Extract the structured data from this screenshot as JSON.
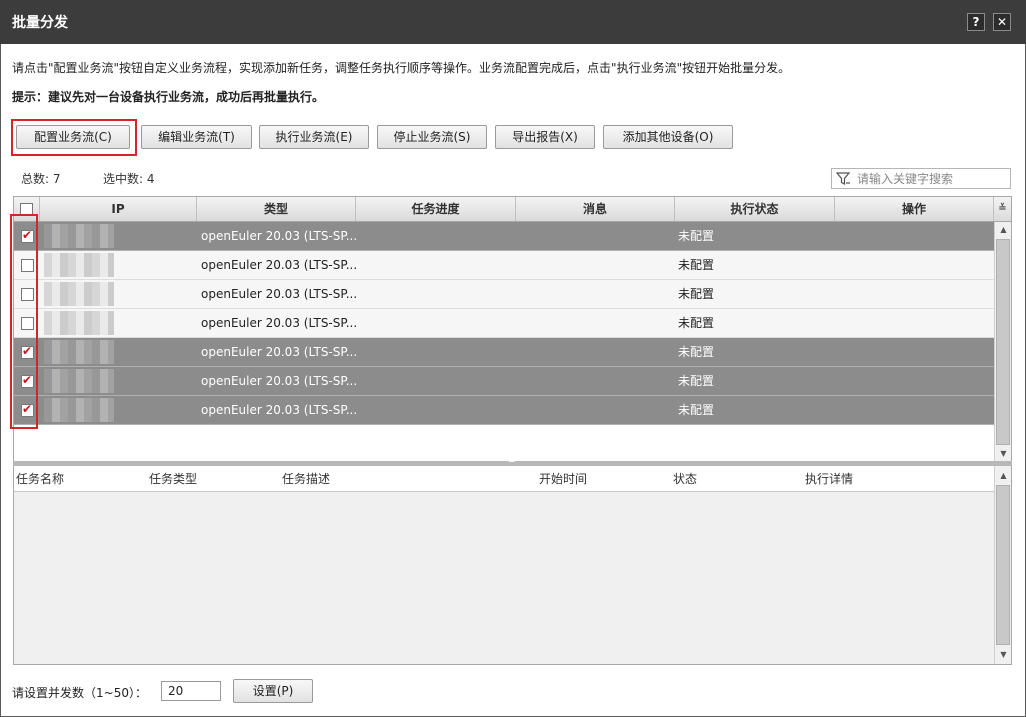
{
  "window": {
    "title": "批量分发",
    "help_label": "?",
    "close_label": "✕"
  },
  "intro_text": "请点击\"配置业务流\"按钮自定义业务流程，实现添加新任务，调整任务执行顺序等操作。业务流配置完成后，点击\"执行业务流\"按钮开始批量分发。",
  "tip_text": "提示：建议先对一台设备执行业务流，成功后再批量执行。",
  "toolbar": {
    "configure": "配置业务流(C)",
    "edit": "编辑业务流(T)",
    "execute": "执行业务流(E)",
    "stop": "停止业务流(S)",
    "export": "导出报告(X)",
    "add_device": "添加其他设备(O)"
  },
  "summary": {
    "total": "总数: 7",
    "selected": "选中数: 4"
  },
  "search": {
    "placeholder": "请输入关键字搜索"
  },
  "device_table": {
    "columns": [
      "IP",
      "类型",
      "任务进度",
      "消息",
      "执行状态",
      "操作"
    ],
    "rows": [
      {
        "checked": true,
        "type": "openEuler 20.03 (LTS-SP...",
        "progress": "",
        "message": "",
        "status": "未配置",
        "action": ""
      },
      {
        "checked": false,
        "type": "openEuler 20.03 (LTS-SP...",
        "progress": "",
        "message": "",
        "status": "未配置",
        "action": ""
      },
      {
        "checked": false,
        "type": "openEuler 20.03 (LTS-SP...",
        "progress": "",
        "message": "",
        "status": "未配置",
        "action": ""
      },
      {
        "checked": false,
        "type": "openEuler 20.03 (LTS-SP...",
        "progress": "",
        "message": "",
        "status": "未配置",
        "action": ""
      },
      {
        "checked": true,
        "type": "openEuler 20.03 (LTS-SP...",
        "progress": "",
        "message": "",
        "status": "未配置",
        "action": ""
      },
      {
        "checked": true,
        "type": "openEuler 20.03 (LTS-SP...",
        "progress": "",
        "message": "",
        "status": "未配置",
        "action": ""
      },
      {
        "checked": true,
        "type": "openEuler 20.03 (LTS-SP...",
        "progress": "",
        "message": "",
        "status": "未配置",
        "action": ""
      }
    ]
  },
  "task_table": {
    "columns": [
      "任务名称",
      "任务类型",
      "任务描述",
      "开始时间",
      "状态",
      "执行详情"
    ]
  },
  "concurrency": {
    "label": "请设置并发数（1~50）：",
    "value": "20",
    "set_button": "设置(P)"
  },
  "colors": {
    "titlebar": "#3c3c3c",
    "selected_row": "#8c8c8c",
    "highlight": "#d6242a",
    "check_mark": "#c0181e"
  }
}
